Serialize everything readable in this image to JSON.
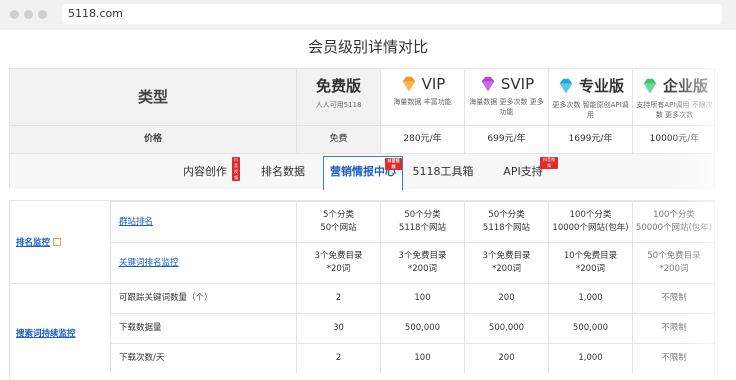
{
  "browser": {
    "url": "5118.com"
  },
  "page_title": "会员级别详情对比",
  "header": {
    "type_label": "类型",
    "price_label": "价格",
    "plans": [
      {
        "name": "免费版",
        "desc": "人人可用5118",
        "price": "免费",
        "icon": "none"
      },
      {
        "name": "VIP",
        "desc": "海量数据 丰富功能",
        "price": "280元/年",
        "icon": "orange-diamond-icon",
        "color": "#f39a1e"
      },
      {
        "name": "SVIP",
        "desc": "海量数据 更多次数 更多功能",
        "price": "699元/年",
        "icon": "purple-diamond-icon",
        "color": "#b144d9"
      },
      {
        "name": "专业版",
        "desc": "更多次数 智能原创API调用",
        "price": "1699元/年",
        "icon": "blue-diamond-icon",
        "color": "#1ea7e6"
      },
      {
        "name": "企业版",
        "desc": "支持所有API调用 不限次数 更多次数",
        "price": "10000元/年",
        "icon": "green-diamond-icon",
        "color": "#3cc46e"
      }
    ]
  },
  "tabs": [
    {
      "label": "内容创作",
      "badge": "抖音视频"
    },
    {
      "label": "排名数据",
      "badge": ""
    },
    {
      "label": "营销情报中心",
      "badge": "抖音视频",
      "active": true
    },
    {
      "label": "5118工具箱",
      "badge": ""
    },
    {
      "label": "API支持",
      "badge": "抖音视频"
    }
  ],
  "table": {
    "categories": [
      "排名监控",
      "搜索词持续监控"
    ],
    "rows": [
      {
        "label": "群站排名",
        "label_link": true,
        "values": [
          "5个分类\n50个网站",
          "50个分类\n5118个网站",
          "50个分类\n5118个网站",
          "100个分类\n10000个网站(包年)",
          "100个分类\n50000个网站(包年)"
        ]
      },
      {
        "label": "关键词排名监控",
        "label_link": true,
        "values": [
          "3个免费目录\n*20词",
          "3个免费目录\n*200词",
          "3个免费目录\n*200词",
          "10个免费目录\n*200词",
          "50个免费目录\n*200词"
        ]
      },
      {
        "label": "可跟踪关键词数量（个）",
        "label_link": false,
        "values": [
          "2",
          "100",
          "200",
          "1,000",
          "不限制"
        ]
      },
      {
        "label": "下载数据量",
        "label_link": false,
        "values": [
          "30",
          "500,000",
          "500,000",
          "500,000",
          "不限制"
        ]
      },
      {
        "label": "下载次数/天",
        "label_link": false,
        "values": [
          "2",
          "100",
          "200",
          "1,000",
          "不限制"
        ]
      }
    ]
  }
}
